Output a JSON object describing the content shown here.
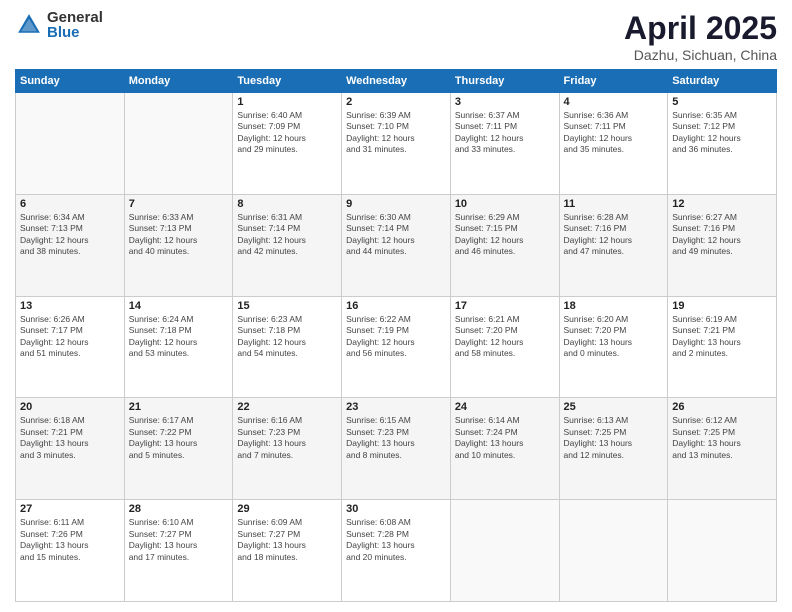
{
  "header": {
    "logo_general": "General",
    "logo_blue": "Blue",
    "title": "April 2025",
    "location": "Dazhu, Sichuan, China"
  },
  "columns": [
    "Sunday",
    "Monday",
    "Tuesday",
    "Wednesday",
    "Thursday",
    "Friday",
    "Saturday"
  ],
  "weeks": [
    [
      {
        "day": "",
        "info": ""
      },
      {
        "day": "",
        "info": ""
      },
      {
        "day": "1",
        "info": "Sunrise: 6:40 AM\nSunset: 7:09 PM\nDaylight: 12 hours\nand 29 minutes."
      },
      {
        "day": "2",
        "info": "Sunrise: 6:39 AM\nSunset: 7:10 PM\nDaylight: 12 hours\nand 31 minutes."
      },
      {
        "day": "3",
        "info": "Sunrise: 6:37 AM\nSunset: 7:11 PM\nDaylight: 12 hours\nand 33 minutes."
      },
      {
        "day": "4",
        "info": "Sunrise: 6:36 AM\nSunset: 7:11 PM\nDaylight: 12 hours\nand 35 minutes."
      },
      {
        "day": "5",
        "info": "Sunrise: 6:35 AM\nSunset: 7:12 PM\nDaylight: 12 hours\nand 36 minutes."
      }
    ],
    [
      {
        "day": "6",
        "info": "Sunrise: 6:34 AM\nSunset: 7:13 PM\nDaylight: 12 hours\nand 38 minutes."
      },
      {
        "day": "7",
        "info": "Sunrise: 6:33 AM\nSunset: 7:13 PM\nDaylight: 12 hours\nand 40 minutes."
      },
      {
        "day": "8",
        "info": "Sunrise: 6:31 AM\nSunset: 7:14 PM\nDaylight: 12 hours\nand 42 minutes."
      },
      {
        "day": "9",
        "info": "Sunrise: 6:30 AM\nSunset: 7:14 PM\nDaylight: 12 hours\nand 44 minutes."
      },
      {
        "day": "10",
        "info": "Sunrise: 6:29 AM\nSunset: 7:15 PM\nDaylight: 12 hours\nand 46 minutes."
      },
      {
        "day": "11",
        "info": "Sunrise: 6:28 AM\nSunset: 7:16 PM\nDaylight: 12 hours\nand 47 minutes."
      },
      {
        "day": "12",
        "info": "Sunrise: 6:27 AM\nSunset: 7:16 PM\nDaylight: 12 hours\nand 49 minutes."
      }
    ],
    [
      {
        "day": "13",
        "info": "Sunrise: 6:26 AM\nSunset: 7:17 PM\nDaylight: 12 hours\nand 51 minutes."
      },
      {
        "day": "14",
        "info": "Sunrise: 6:24 AM\nSunset: 7:18 PM\nDaylight: 12 hours\nand 53 minutes."
      },
      {
        "day": "15",
        "info": "Sunrise: 6:23 AM\nSunset: 7:18 PM\nDaylight: 12 hours\nand 54 minutes."
      },
      {
        "day": "16",
        "info": "Sunrise: 6:22 AM\nSunset: 7:19 PM\nDaylight: 12 hours\nand 56 minutes."
      },
      {
        "day": "17",
        "info": "Sunrise: 6:21 AM\nSunset: 7:20 PM\nDaylight: 12 hours\nand 58 minutes."
      },
      {
        "day": "18",
        "info": "Sunrise: 6:20 AM\nSunset: 7:20 PM\nDaylight: 13 hours\nand 0 minutes."
      },
      {
        "day": "19",
        "info": "Sunrise: 6:19 AM\nSunset: 7:21 PM\nDaylight: 13 hours\nand 2 minutes."
      }
    ],
    [
      {
        "day": "20",
        "info": "Sunrise: 6:18 AM\nSunset: 7:21 PM\nDaylight: 13 hours\nand 3 minutes."
      },
      {
        "day": "21",
        "info": "Sunrise: 6:17 AM\nSunset: 7:22 PM\nDaylight: 13 hours\nand 5 minutes."
      },
      {
        "day": "22",
        "info": "Sunrise: 6:16 AM\nSunset: 7:23 PM\nDaylight: 13 hours\nand 7 minutes."
      },
      {
        "day": "23",
        "info": "Sunrise: 6:15 AM\nSunset: 7:23 PM\nDaylight: 13 hours\nand 8 minutes."
      },
      {
        "day": "24",
        "info": "Sunrise: 6:14 AM\nSunset: 7:24 PM\nDaylight: 13 hours\nand 10 minutes."
      },
      {
        "day": "25",
        "info": "Sunrise: 6:13 AM\nSunset: 7:25 PM\nDaylight: 13 hours\nand 12 minutes."
      },
      {
        "day": "26",
        "info": "Sunrise: 6:12 AM\nSunset: 7:25 PM\nDaylight: 13 hours\nand 13 minutes."
      }
    ],
    [
      {
        "day": "27",
        "info": "Sunrise: 6:11 AM\nSunset: 7:26 PM\nDaylight: 13 hours\nand 15 minutes."
      },
      {
        "day": "28",
        "info": "Sunrise: 6:10 AM\nSunset: 7:27 PM\nDaylight: 13 hours\nand 17 minutes."
      },
      {
        "day": "29",
        "info": "Sunrise: 6:09 AM\nSunset: 7:27 PM\nDaylight: 13 hours\nand 18 minutes."
      },
      {
        "day": "30",
        "info": "Sunrise: 6:08 AM\nSunset: 7:28 PM\nDaylight: 13 hours\nand 20 minutes."
      },
      {
        "day": "",
        "info": ""
      },
      {
        "day": "",
        "info": ""
      },
      {
        "day": "",
        "info": ""
      }
    ]
  ]
}
